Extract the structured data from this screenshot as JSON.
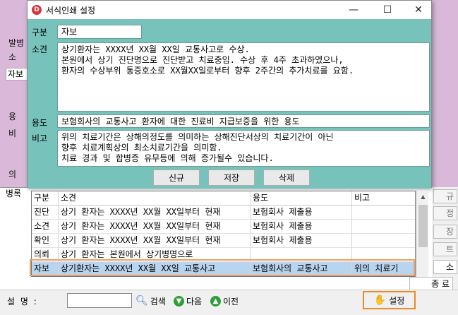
{
  "background": {
    "left_labels": [
      "발병",
      "소",
      "용",
      "비",
      "의"
    ],
    "combo_value": "자보",
    "grid_header": "병록",
    "right_buttons": [
      "규",
      "정",
      "장",
      "트",
      "소",
      "료"
    ],
    "right_button_last": "종 료"
  },
  "dialog": {
    "title": "서식인쇄 설정",
    "app_icon": "D",
    "window_buttons": [
      "—",
      "☐",
      "✕"
    ],
    "labels": {
      "category": "구분",
      "finding": "소견",
      "purpose": "용도",
      "note": "비고"
    },
    "category_value": "자보",
    "finding_value": "상기환자는 XXXX년 XX월 XX일 교통사고로 수상.\n본원에서 상기 진단명으로 진단받고 치료중임. 수상 후 4주 초과하였으나,\n환자의 수상부위 통증호소로 XX월XX일로부터 향후 2주간의 추가치료를 요함.",
    "purpose_value": "보험회사의 교통사고 환자에 대한 진료비 지급보증을 위한 용도",
    "note_value": "위의 치료기간은 상해의정도를 의미하는 상해진단서상의 치료기간이 아닌\n향후 치료계획상의 최소치료기간을 의미함.\n치료 경과 및 합병증 유무등에 의해 증가될수 있습니다.",
    "buttons": {
      "new": "신규",
      "save": "저장",
      "delete": "삭제"
    },
    "table": {
      "columns": [
        "구분",
        "소견",
        "용도",
        "비고"
      ],
      "rows": [
        [
          "진단",
          "상기 환자는 XXXX년 XX월 XX일부터 현재",
          "보험회사 제출용",
          ""
        ],
        [
          "소견",
          "상기 환자는 XXXX년 XX월 XX일부터 현재",
          "보험회사 제출용",
          ""
        ],
        [
          "확인",
          "상기 환자는 XXXX년 XX월 XX일부터 현재",
          "보험회사 제출용",
          ""
        ],
        [
          "의뢰",
          "상기 환자는 본원에서 상기병명으로",
          "",
          ""
        ],
        [
          "자보",
          "상기환자는 XXXX년 XX월 XX일 교통사고",
          "보험회사의 교통사고",
          "위의 치료기"
        ]
      ]
    }
  },
  "bottom": {
    "name_label": "설 명 :",
    "name_value": "",
    "search_label": "검색",
    "next_label": "다음",
    "prev_label": "이전",
    "settings_label": "설정"
  }
}
